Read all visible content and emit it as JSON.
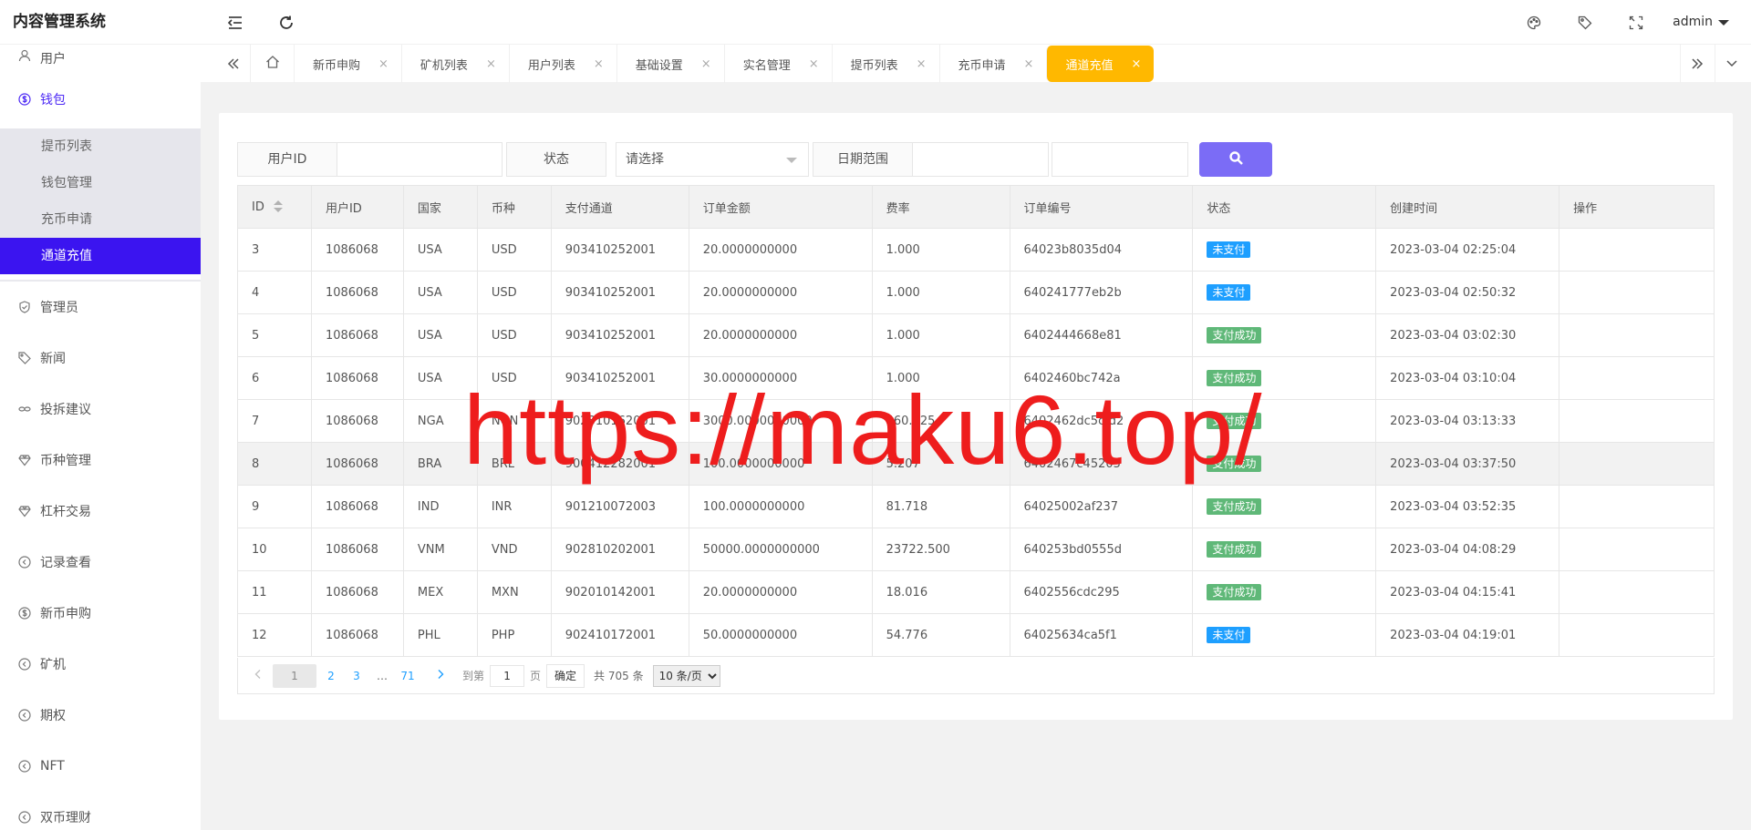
{
  "app": {
    "title": "内容管理系统"
  },
  "header": {
    "user_name": "admin",
    "icons": [
      "menu-fold-icon",
      "refresh-icon",
      "palette-icon",
      "tag-icon",
      "fullscreen-icon"
    ]
  },
  "sidebar": {
    "items": [
      {
        "label": "用户",
        "icon": "user-icon"
      },
      {
        "label": "钱包",
        "icon": "dollar-icon"
      },
      {
        "label": "管理员",
        "icon": "shield-icon"
      },
      {
        "label": "新闻",
        "icon": "tag-icon"
      },
      {
        "label": "投拆建议",
        "icon": "link-icon"
      },
      {
        "label": "币种管理",
        "icon": "diamond-icon"
      },
      {
        "label": "杠杆交易",
        "icon": "diamond-icon"
      },
      {
        "label": "记录查看",
        "icon": "circle-arrow-icon"
      },
      {
        "label": "新币申购",
        "icon": "dollar-icon"
      },
      {
        "label": "矿机",
        "icon": "circle-arrow-icon"
      },
      {
        "label": "期权",
        "icon": "circle-arrow-icon"
      },
      {
        "label": "NFT",
        "icon": "circle-arrow-icon"
      },
      {
        "label": "双币理财",
        "icon": "circle-arrow-icon"
      }
    ],
    "wallet_sub": [
      "提币列表",
      "钱包管理",
      "充币申请",
      "通道充值"
    ]
  },
  "tabs": {
    "items": [
      {
        "label": "新币申购",
        "close": "×"
      },
      {
        "label": "矿机列表",
        "close": "×"
      },
      {
        "label": "用户列表",
        "close": "×"
      },
      {
        "label": "基础设置",
        "close": "×"
      },
      {
        "label": "实名管理",
        "close": "×"
      },
      {
        "label": "提币列表",
        "close": "×"
      },
      {
        "label": "充币申请",
        "close": "×"
      },
      {
        "label": "通道充值",
        "close": "×"
      }
    ],
    "active_index": 7
  },
  "filter": {
    "user_id_label": "用户ID",
    "user_id_value": "",
    "status_label": "状态",
    "status_selected": "请选择",
    "date_label": "日期范围",
    "date_start": "",
    "date_end": ""
  },
  "table": {
    "columns": [
      "ID",
      "用户ID",
      "国家",
      "币种",
      "支付通道",
      "订单金额",
      "费率",
      "订单编号",
      "状态",
      "创建时间",
      "操作"
    ],
    "rows": [
      [
        "3",
        "1086068",
        "USA",
        "USD",
        "903410252001",
        "20.0000000000",
        "1.000",
        "64023b8035d04",
        "未支付",
        "2023-03-04 02:25:04",
        ""
      ],
      [
        "4",
        "1086068",
        "USA",
        "USD",
        "903410252001",
        "20.0000000000",
        "1.000",
        "640241777eb2b",
        "未支付",
        "2023-03-04 02:50:32",
        ""
      ],
      [
        "5",
        "1086068",
        "USA",
        "USD",
        "903410252001",
        "20.0000000000",
        "1.000",
        "6402444668e81",
        "支付成功",
        "2023-03-04 03:02:30",
        ""
      ],
      [
        "6",
        "1086068",
        "USA",
        "USD",
        "903410252001",
        "30.0000000000",
        "1.000",
        "6402460bc742a",
        "支付成功",
        "2023-03-04 03:10:04",
        ""
      ],
      [
        "7",
        "1086068",
        "NGA",
        "NGN",
        "902310162001",
        "3000.0000000000",
        "460.125",
        "6402462dc5cfd2",
        "支付成功",
        "2023-03-04 03:13:33",
        ""
      ],
      [
        "8",
        "1086068",
        "BRA",
        "BRL",
        "900412282001",
        "100.0000000000",
        "5.207",
        "6402467c45205",
        "支付成功",
        "2023-03-04 03:37:50",
        ""
      ],
      [
        "9",
        "1086068",
        "IND",
        "INR",
        "901210072003",
        "100.0000000000",
        "81.718",
        "64025002af237",
        "支付成功",
        "2023-03-04 03:52:35",
        ""
      ],
      [
        "10",
        "1086068",
        "VNM",
        "VND",
        "902810202001",
        "50000.0000000000",
        "23722.500",
        "640253bd0555d",
        "支付成功",
        "2023-03-04 04:08:29",
        ""
      ],
      [
        "11",
        "1086068",
        "MEX",
        "MXN",
        "902010142001",
        "20.0000000000",
        "18.016",
        "6402556cdc295",
        "支付成功",
        "2023-03-04 04:15:41",
        ""
      ],
      [
        "12",
        "1086068",
        "PHL",
        "PHP",
        "902410172001",
        "50.0000000000",
        "54.776",
        "64025634ca5f1",
        "未支付",
        "2023-03-04 04:19:01",
        ""
      ]
    ],
    "highlighted_row": 5
  },
  "pagination": {
    "current": "1",
    "pages": [
      "2",
      "3"
    ],
    "ellipsis": "…",
    "last": "71",
    "goto_prefix": "到第",
    "goto_value": "1",
    "goto_suffix": "页",
    "confirm": "确定",
    "total": "共 705 条",
    "limit": "10 条/页"
  },
  "colors": {
    "accent": "#3b14f0",
    "active_tab": "#ffb800",
    "search_button": "#7b6cf6",
    "unpaid_badge": "#1e9fff",
    "paid_badge": "#5fb878"
  },
  "watermark": {
    "text": "https://maku6.top/"
  }
}
